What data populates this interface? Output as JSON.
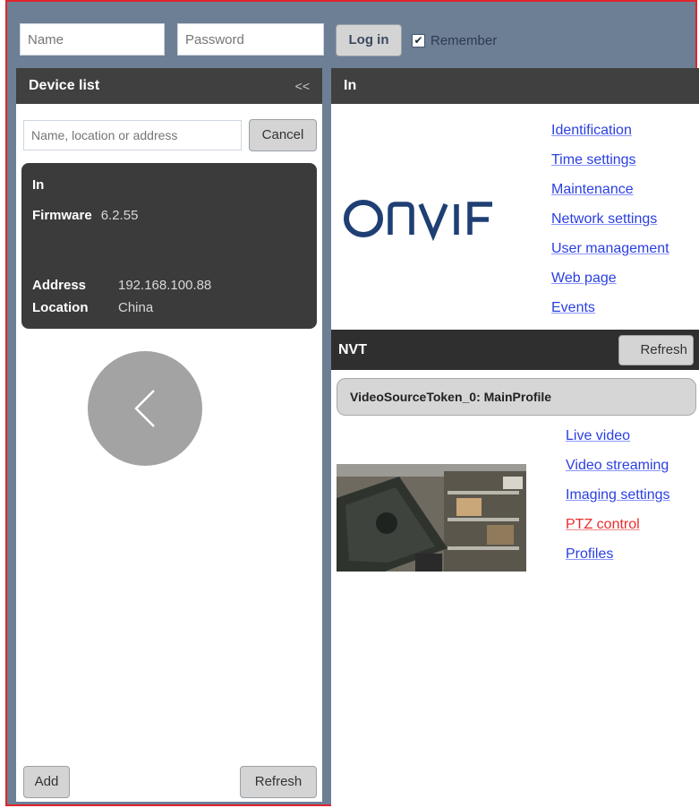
{
  "login": {
    "name_placeholder": "Name",
    "password_placeholder": "Password",
    "login_label": "Log in",
    "remember_label": "Remember",
    "remember_checked": true
  },
  "device_list": {
    "title": "Device list",
    "collapse_icon": "double-chevron-left-icon",
    "search_placeholder": "Name, location or address",
    "cancel_label": "Cancel",
    "device": {
      "name": "In",
      "firmware_label": "Firmware",
      "firmware_value": "6.2.55",
      "address_label": "Address",
      "address_value": "192.168.100.88",
      "location_label": "Location",
      "location_value": "China"
    },
    "back_icon": "chevron-left-icon",
    "add_label": "Add",
    "refresh_label": "Refresh"
  },
  "device_panel": {
    "title": "In",
    "logo_text": "ONVIF",
    "links": [
      "Identification",
      "Time settings",
      "Maintenance",
      "Network settings",
      "User management",
      "Web page",
      "Events"
    ],
    "nvt_label": "NVT",
    "nvt_refresh_label": "Refresh",
    "profile_label": "VideoSourceToken_0: MainProfile",
    "profile_links": [
      "Live video",
      "Video streaming",
      "Imaging settings",
      "PTZ control",
      "Profiles"
    ],
    "active_profile_link": "PTZ control"
  },
  "colors": {
    "background": "#6d7f95",
    "header": "#404040",
    "link": "#2a3fe0",
    "link_active": "#ee2a2a",
    "frame_border": "#e0242b"
  }
}
